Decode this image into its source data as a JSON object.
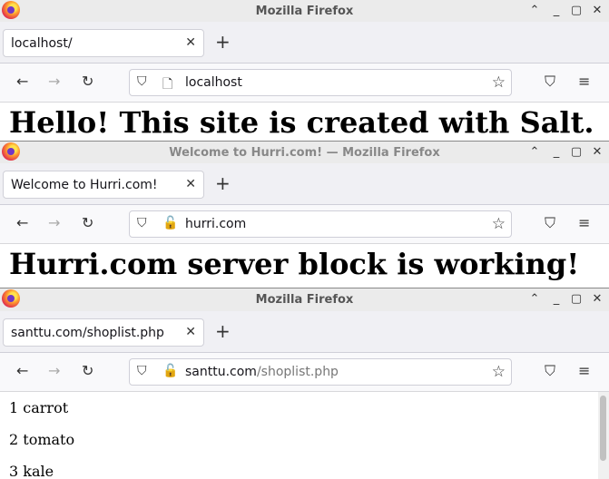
{
  "windows": [
    {
      "title": "Mozilla Firefox",
      "tab_title": "localhost/",
      "url_host": "localhost",
      "url_path": "",
      "insecure": false,
      "heading": "Hello! This site is created with Salt."
    },
    {
      "title": "Welcome to Hurri.com! — Mozilla Firefox",
      "tab_title": "Welcome to Hurri.com!",
      "url_host": "hurri.com",
      "url_path": "",
      "insecure": true,
      "heading": "Hurri.com server block is working!"
    },
    {
      "title": "Mozilla Firefox",
      "tab_title": "santtu.com/shoplist.php",
      "url_host": "santtu.com",
      "url_path": "/shoplist.php",
      "insecure": true,
      "list": [
        "1 carrot",
        "2 tomato",
        "3 kale"
      ]
    }
  ],
  "icons": {
    "minimize": "minimize-icon",
    "maximize": "maximize-icon",
    "close": "close-icon",
    "back": "back-arrow-icon",
    "forward": "forward-arrow-icon",
    "reload": "reload-icon",
    "shield": "shield-icon",
    "bookmark": "star-icon",
    "pocket": "pocket-icon",
    "menu": "hamburger-menu-icon"
  }
}
